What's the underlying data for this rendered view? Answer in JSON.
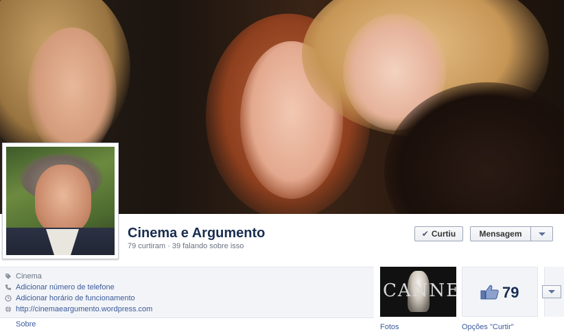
{
  "page": {
    "name": "Cinema e Argumento",
    "likes_count_text": "79 curtiram",
    "separator": "·",
    "talking_text": "39 falando sobre isso"
  },
  "actions": {
    "liked_label": "Curtiu",
    "message_label": "Mensagem"
  },
  "info": {
    "category": "Cinema",
    "add_phone": "Adicionar número de telefone",
    "add_hours": "Adicionar horário de funcionamento",
    "website": "http://cinemaeargumento.wordpress.com"
  },
  "tabs": {
    "about": "Sobre",
    "photos": "Fotos",
    "like_options": "Opções \"Curtir\""
  },
  "photos_tile": {
    "image_text": "CANNES"
  },
  "likes_tile": {
    "count": "79"
  },
  "colors": {
    "brand_blue": "#3b5998",
    "name_color": "#1a2d4f",
    "panel_bg": "#f2f4f8"
  },
  "icons": {
    "category": "tag-icon",
    "phone": "phone-icon",
    "hours": "clock-icon",
    "website": "globe-icon",
    "liked": "check-icon",
    "dropdown": "caret-down-icon",
    "likes": "thumbs-up-icon"
  }
}
